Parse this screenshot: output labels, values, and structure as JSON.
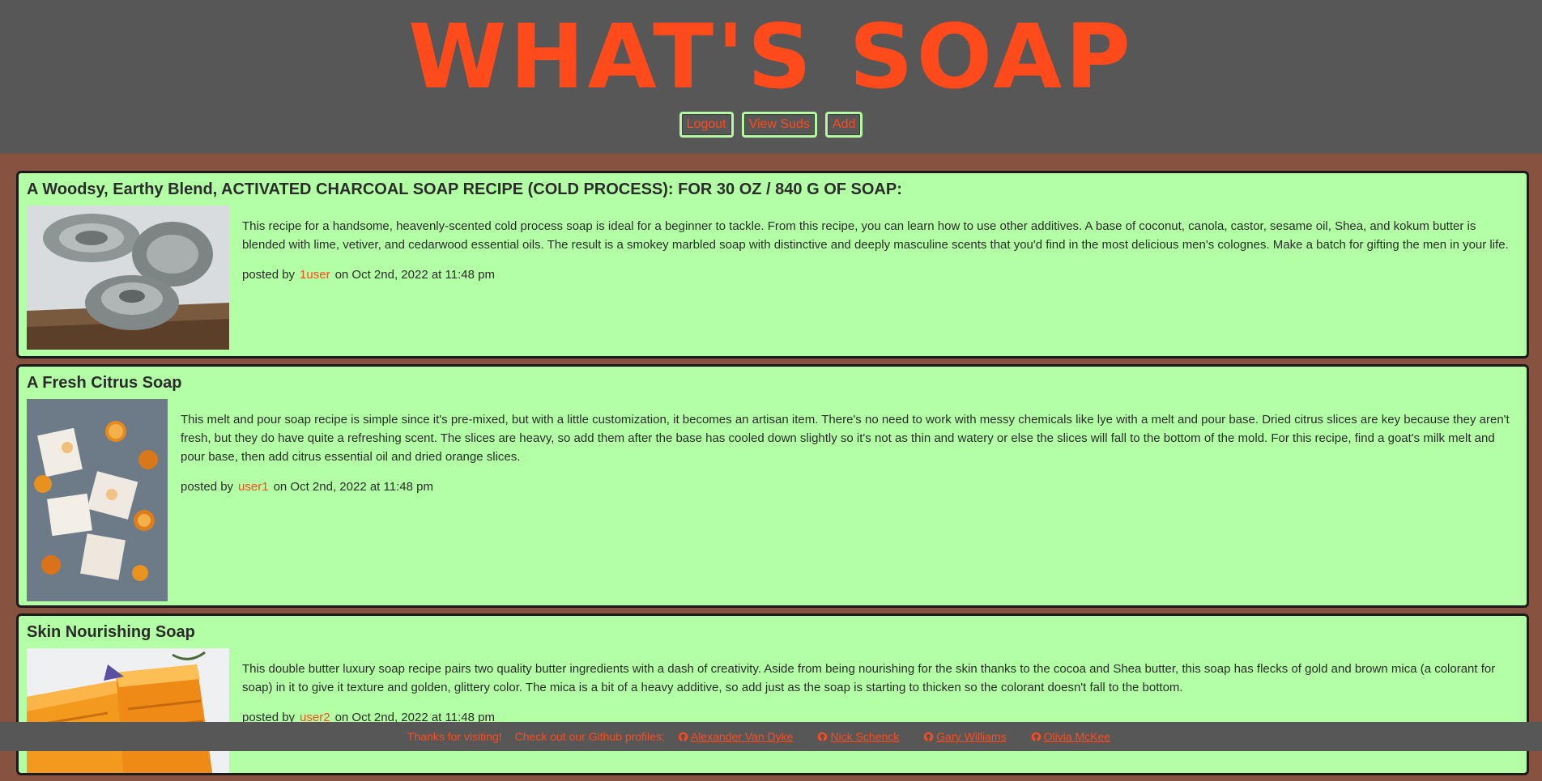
{
  "header": {
    "logo": "WHAT'S SOAP",
    "nav": [
      "Logout",
      "View Suds",
      "Add"
    ]
  },
  "posts": [
    {
      "title": "A Woodsy, Earthy Blend, ACTIVATED CHARCOAL SOAP RECIPE (COLD PROCESS): FOR 30 OZ / 840 G OF SOAP:",
      "body": "This recipe for a handsome, heavenly-scented cold process soap is ideal for a beginner to tackle. From this recipe, you can learn how to use other additives. A base of coconut, canola, castor, sesame oil, Shea, and kokum butter is blended with lime, vetiver, and cedarwood essential oils. The result is a smokey marbled soap with distinctive and deeply masculine scents that you'd find in the most delicious men's colognes. Make a batch for gifting the men in your life.",
      "posted_by": "posted by",
      "user": "1user",
      "date": "on Oct 2nd, 2022 at 11:48 pm"
    },
    {
      "title": "A Fresh Citrus Soap",
      "body": "This melt and pour soap recipe is simple since it's pre-mixed, but with a little customization, it becomes an artisan item. There's no need to work with messy chemicals like lye with a melt and pour base. Dried citrus slices are key because they aren't fresh, but they do have quite a refreshing scent. The slices are heavy, so add them after the base has cooled down slightly so it's not as thin and watery or else the slices will fall to the bottom of the mold. For this recipe, find a goat's milk melt and pour base, then add citrus essential oil and dried orange slices.",
      "posted_by": "posted by",
      "user": "user1",
      "date": "on Oct 2nd, 2022 at 11:48 pm"
    },
    {
      "title": "Skin Nourishing Soap",
      "body": "This double butter luxury soap recipe pairs two quality butter ingredients with a dash of creativity. Aside from being nourishing for the skin thanks to the cocoa and Shea butter, this soap has flecks of gold and brown mica (a colorant for soap) in it to give it texture and golden, glittery color. The mica is a bit of a heavy additive, so add just as the soap is starting to thicken so the colorant doesn't fall to the bottom.",
      "posted_by": "posted by",
      "user": "user2",
      "date": "on Oct 2nd, 2022 at 11:48 pm"
    }
  ],
  "footer": {
    "thanks": "Thanks for visiting!",
    "checkout": "Check out our Github profiles:",
    "profiles": [
      "Alexander Van Dyke",
      "Nick Schenck",
      "Gary Williams",
      "Olivia McKee"
    ],
    "icon": "github-icon"
  },
  "colors": {
    "accent": "#ff4a1c",
    "header_bg": "#575757",
    "page_bg": "#87523f",
    "card_bg": "#b3ffa6"
  }
}
